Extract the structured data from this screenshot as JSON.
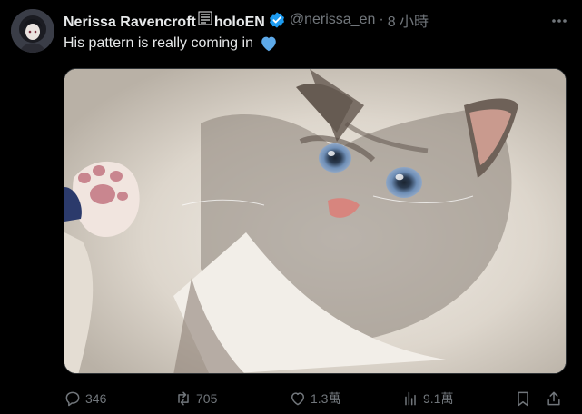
{
  "author": {
    "display_name_part1": "Nerissa Ravencroft",
    "display_name_part2": "holoEN",
    "handle": "@nerissa_en",
    "separator": "·",
    "time": "8 小時"
  },
  "tweet": {
    "text": "His pattern is really coming in"
  },
  "actions": {
    "replies": "346",
    "retweets": "705",
    "likes": "1.3萬",
    "views": "9.1萬"
  },
  "icons": {
    "verified": "verified-badge-icon",
    "more": "more-dots-icon",
    "reply": "reply-icon",
    "retweet": "retweet-icon",
    "like": "heart-icon",
    "views": "views-chart-icon",
    "bookmark": "bookmark-icon",
    "share": "share-icon"
  },
  "colors": {
    "background": "#000000",
    "text": "#e7e9ea",
    "muted": "#71767b",
    "verified": "#1d9bf0",
    "heart_emoji": "#5da9e9"
  }
}
